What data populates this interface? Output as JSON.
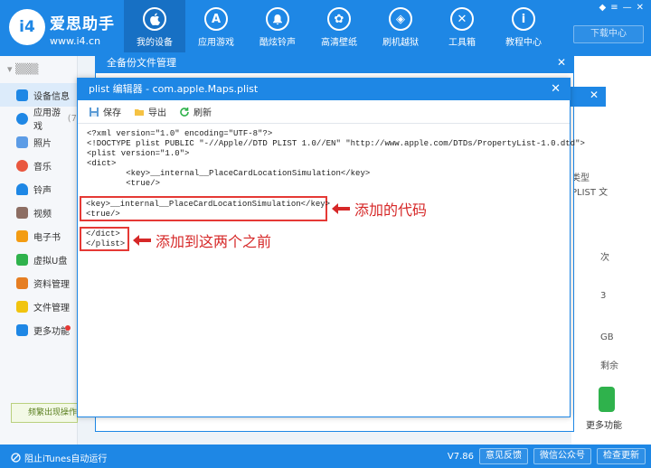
{
  "app": {
    "brand_name": "爱思助手",
    "brand_url": "www.i4.cn",
    "logo_text": "i4"
  },
  "nav": [
    {
      "label": "我的设备",
      "icon": "apple-icon",
      "glyph": ""
    },
    {
      "label": "应用游戏",
      "icon": "app-store-icon",
      "glyph": "A"
    },
    {
      "label": "酷炫铃声",
      "icon": "bell-icon",
      "glyph": "♪"
    },
    {
      "label": "高清壁纸",
      "icon": "flower-icon",
      "glyph": "✿"
    },
    {
      "label": "刷机越狱",
      "icon": "box-icon",
      "glyph": "◈"
    },
    {
      "label": "工具箱",
      "icon": "tools-icon",
      "glyph": "✕"
    },
    {
      "label": "教程中心",
      "icon": "info-icon",
      "glyph": "i"
    }
  ],
  "download_center": "下载中心",
  "sidebar": {
    "device_name": "▾ ▒▒▒",
    "items": [
      {
        "label": "设备信息",
        "color": "#1e87e5"
      },
      {
        "label": "应用游戏",
        "suffix": "(7",
        "color": "#1e87e5"
      },
      {
        "label": "照片",
        "color": "#5c9ce6"
      },
      {
        "label": "音乐",
        "color": "#e9573f"
      },
      {
        "label": "铃声",
        "color": "#1e87e5"
      },
      {
        "label": "视频",
        "color": "#8d6e63"
      },
      {
        "label": "电子书",
        "color": "#f39c12"
      },
      {
        "label": "虚拟U盘",
        "color": "#2fb24c"
      },
      {
        "label": "资料管理",
        "color": "#e67e22"
      },
      {
        "label": "文件管理",
        "color": "#f1c40f"
      },
      {
        "label": "更多功能",
        "color": "#1e87e5"
      }
    ],
    "freq_button": "频繁出现操作失"
  },
  "right_panel": {
    "t1": "类型",
    "t2": "PLIST 文",
    "t3": "次",
    "t4": "3",
    "t5": "GB",
    "t6": "剩余",
    "more": "更多功能"
  },
  "status": {
    "itunes": "阻止iTunes自动运行",
    "version": "V7.86",
    "feedback": "意见反馈",
    "wechat": "微信公众号",
    "update": "检查更新"
  },
  "backup_dialog": {
    "title": "全备份文件管理"
  },
  "editor": {
    "title": "plist 编辑器 - com.apple.Maps.plist",
    "toolbar": {
      "save": "保存",
      "export": "导出",
      "refresh": "刷新"
    },
    "code_top": "<?xml version=\"1.0\" encoding=\"UTF-8\"?>\n<!DOCTYPE plist PUBLIC \"-//Apple//DTD PLIST 1.0//EN\" \"http://www.apple.com/DTDs/PropertyList-1.0.dtd\">\n<plist version=\"1.0\">\n<dict>\n        <key>__internal__PlaceCardLocationSimulation</key>\n        <true/>",
    "added_code": "<key>__internal__PlaceCardLocationSimulation</key>\n<true/>",
    "closing_code": "</dict>\n</plist>"
  },
  "annotations": {
    "added": "添加的代码",
    "insert_before": "添加到这两个之前"
  }
}
